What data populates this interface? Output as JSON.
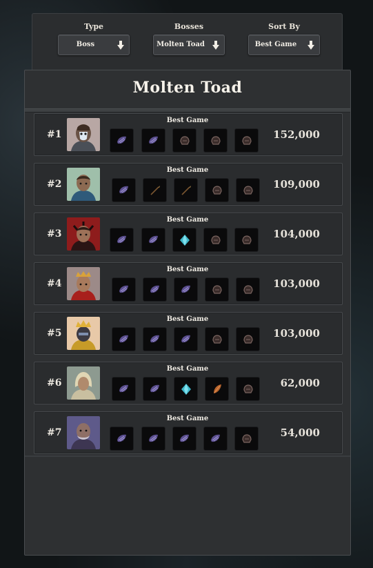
{
  "filters": [
    {
      "label": "Type",
      "value": "Boss"
    },
    {
      "label": "Bosses",
      "value": "Molten Toad"
    },
    {
      "label": "Sort By",
      "value": "Best Game"
    }
  ],
  "panel": {
    "title": "Molten Toad"
  },
  "entries": [
    {
      "rank": "#1",
      "game_label": "Best Game",
      "score": "152,000",
      "items": [
        "purple-shell-icon",
        "purple-shell-icon",
        "dark-helm-icon",
        "dark-helm-icon",
        "dark-helm-icon"
      ]
    },
    {
      "rank": "#2",
      "game_label": "Best Game",
      "score": "109,000",
      "items": [
        "purple-shell-icon",
        "spear-icon",
        "spear-icon",
        "dark-helm-icon",
        "dark-helm-icon"
      ]
    },
    {
      "rank": "#3",
      "game_label": "Best Game",
      "score": "104,000",
      "items": [
        "purple-shell-icon",
        "purple-shell-icon",
        "blue-gem-icon",
        "dark-helm-icon",
        "dark-helm-icon"
      ]
    },
    {
      "rank": "#4",
      "game_label": "Best Game",
      "score": "103,000",
      "items": [
        "purple-shell-icon",
        "purple-shell-icon",
        "purple-shell-icon",
        "dark-helm-icon",
        "dark-helm-icon"
      ]
    },
    {
      "rank": "#5",
      "game_label": "Best Game",
      "score": "103,000",
      "items": [
        "purple-shell-icon",
        "purple-shell-icon",
        "purple-shell-icon",
        "dark-helm-icon",
        "dark-helm-icon"
      ]
    },
    {
      "rank": "#6",
      "game_label": "Best Game",
      "score": "62,000",
      "items": [
        "purple-shell-icon",
        "purple-shell-icon",
        "blue-gem-icon",
        "orange-leaf-icon",
        "dark-helm-icon"
      ]
    },
    {
      "rank": "#7",
      "game_label": "Best Game",
      "score": "54,000",
      "items": [
        "purple-shell-icon",
        "purple-shell-icon",
        "purple-shell-icon",
        "purple-shell-icon",
        "dark-helm-icon"
      ]
    }
  ]
}
